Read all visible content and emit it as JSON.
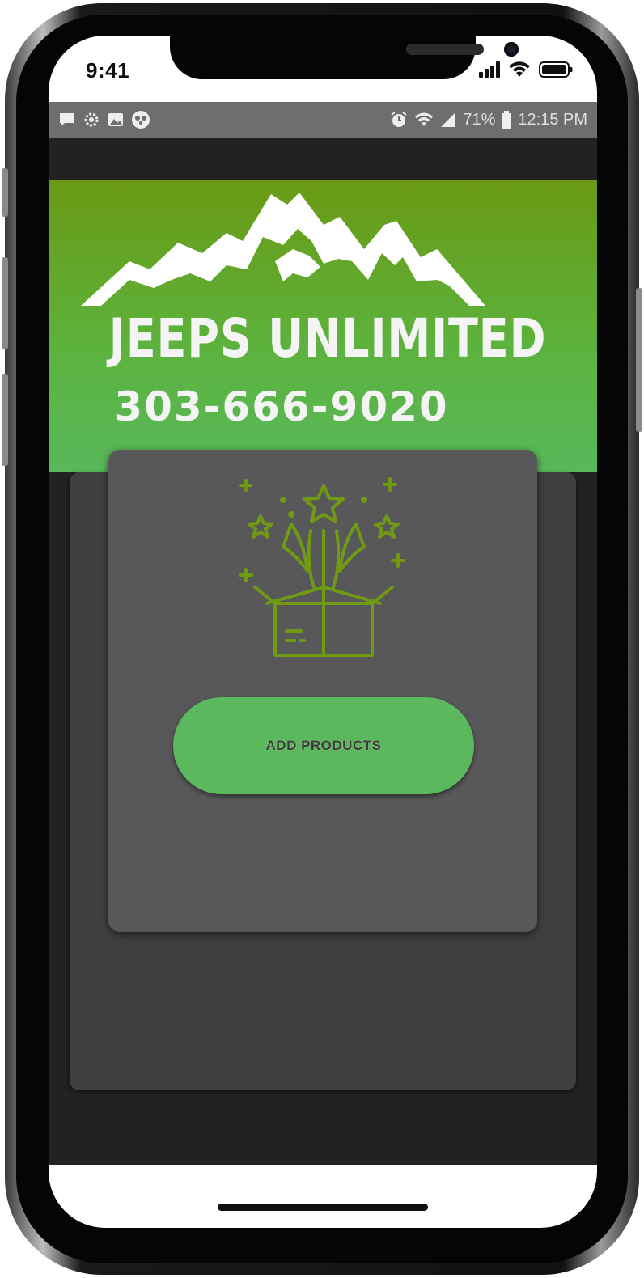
{
  "ios_status": {
    "time": "9:41",
    "icons": [
      "cellular-signal-icon",
      "wifi-icon",
      "battery-icon"
    ]
  },
  "android_status": {
    "left_icons": [
      "message-icon",
      "settings-gear-icon",
      "gallery-icon",
      "panda-app-icon"
    ],
    "right_icons": [
      "alarm-icon",
      "wifi-icon",
      "cell-signal-icon",
      "battery-icon"
    ],
    "battery": "71%",
    "time": "12:15 PM"
  },
  "hero": {
    "brand": "JEEPS UNLIMITED",
    "phone": "303-666-9020"
  },
  "main": {
    "icon": "gift-box-icon",
    "add_products_label": "ADD PRODUCTS"
  },
  "colors": {
    "accent_green": "#5cb85c",
    "header_green_top": "#6a9a14",
    "icon_green": "#6f9a12",
    "background_dark": "#222124",
    "card_dark": "#3f3f41",
    "card_inner": "#58585a"
  }
}
